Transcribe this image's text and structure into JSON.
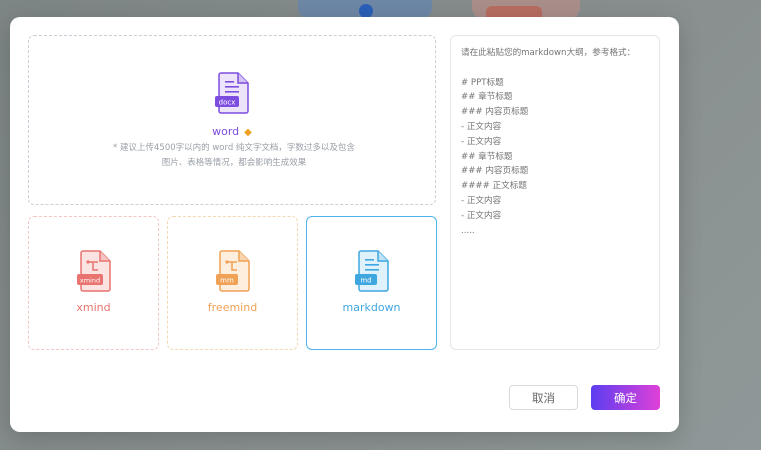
{
  "word_card": {
    "icon_tag": "docx",
    "label": "word",
    "badge": "diamond-icon",
    "hint_line1": "* 建议上传4500字以内的 word 纯文字文档，字数过多以及包含",
    "hint_line2": "图片、表格等情况，都会影响生成效果",
    "color": "#7c4dde"
  },
  "cards": [
    {
      "id": "xmind",
      "icon_tag": "xmind",
      "label": "xmind",
      "color": "#e8736f"
    },
    {
      "id": "freemind",
      "icon_tag": "mm",
      "label": "freemind",
      "color": "#f0a155"
    },
    {
      "id": "markdown",
      "icon_tag": "md",
      "label": "markdown",
      "color": "#3fa7e0"
    }
  ],
  "markdown_input": {
    "placeholder": "请在此粘贴您的markdown大纲，参考格式：\n\n# PPT标题\n## 章节标题\n### 内容页标题\n- 正文内容\n- 正文内容\n## 章节标题\n### 内容页标题\n#### 正文标题\n- 正文内容\n- 正文内容\n....."
  },
  "footer": {
    "cancel_label": "取消",
    "ok_label": "确定"
  }
}
